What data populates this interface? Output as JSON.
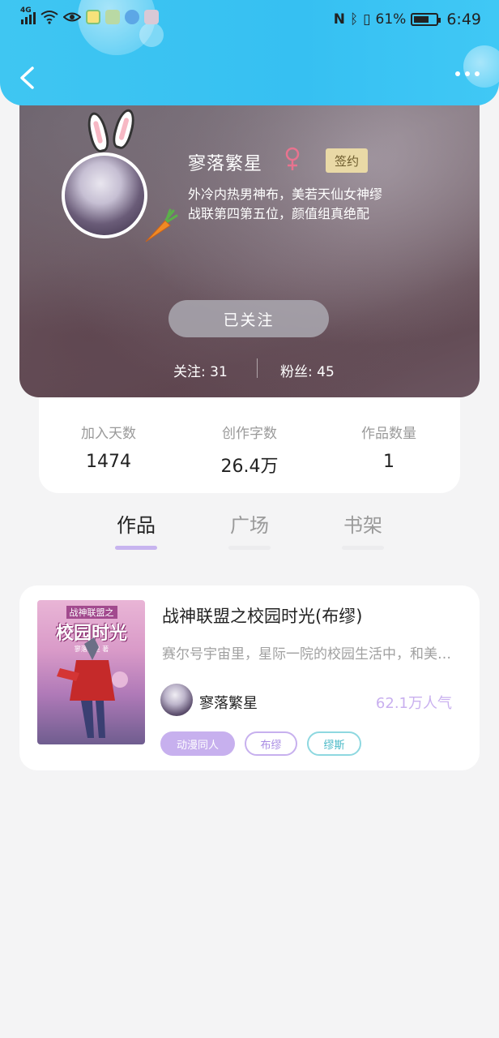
{
  "status_bar": {
    "network": "4G",
    "battery_percent": "61%",
    "time": "6:49"
  },
  "header": {
    "back_icon": "chevron-left-icon",
    "more_icon": "more-dots-icon"
  },
  "profile": {
    "nickname": "寥落繁星",
    "gender_icon": "female-icon",
    "badge": "签约",
    "bio_line1": "外冷内热男神布，美若天仙女神缪",
    "bio_line2": "战联第四第五位，颜值组真绝配",
    "follow_button": "已关注",
    "following": "关注: 31",
    "fans": "粉丝: 45"
  },
  "stats": [
    {
      "label": "加入天数",
      "value": "1474"
    },
    {
      "label": "创作字数",
      "value": "26.4万"
    },
    {
      "label": "作品数量",
      "value": "1"
    }
  ],
  "tabs": [
    {
      "label": "作品",
      "active": true
    },
    {
      "label": "广场",
      "active": false
    },
    {
      "label": "书架",
      "active": false
    }
  ],
  "works": [
    {
      "cover_line1": "战神联盟之",
      "cover_line2": "校园时光",
      "cover_line3": "寥落繁星 著",
      "title": "战神联盟之校园时光(布缪)",
      "description": "赛尔号宇宙里，星际一院的校园生活中，和美好的青春一起",
      "author": "寥落繁星",
      "popularity": "62.1万人气",
      "tags": [
        "动漫同人",
        "布缪",
        "缪斯"
      ]
    }
  ],
  "colors": {
    "header_blue": "#3fc6f2",
    "accent_purple": "#c7b0ee",
    "tag_teal": "#47b8c6",
    "badge_gold": "#e9d9a6"
  }
}
